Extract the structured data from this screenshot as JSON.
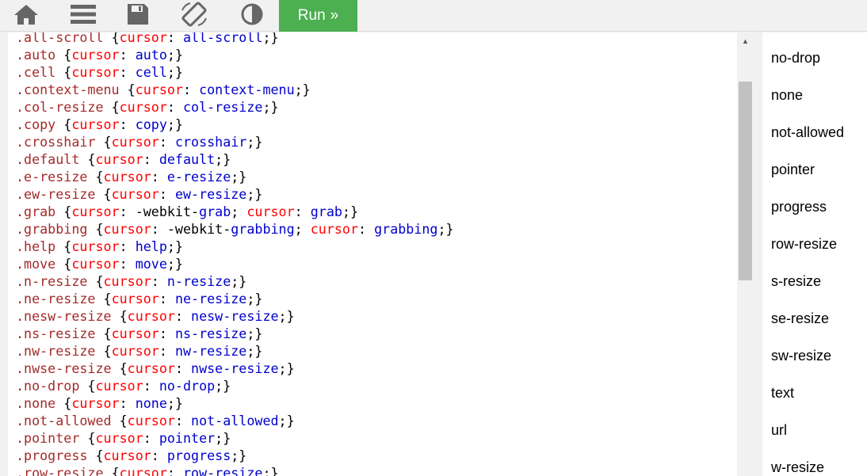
{
  "toolbar": {
    "icons": [
      "home-icon",
      "menu-icon",
      "save-icon",
      "rotate-icon",
      "contrast-icon"
    ],
    "run_label": "Run",
    "run_chevron": "»",
    "run_color": "#4caf50"
  },
  "colors": {
    "selector": "#a52a2a",
    "property": "#ff0000",
    "value": "#0000cd"
  },
  "code_lines": [
    [
      [
        ".all-scroll ",
        "sel"
      ],
      [
        "{",
        "pun"
      ],
      [
        "cursor",
        "prop"
      ],
      [
        ": ",
        "pun"
      ],
      [
        "all-scroll",
        "val"
      ],
      [
        ";}",
        "pun"
      ]
    ],
    [
      [
        ".auto ",
        "sel"
      ],
      [
        "{",
        "pun"
      ],
      [
        "cursor",
        "prop"
      ],
      [
        ": ",
        "pun"
      ],
      [
        "auto",
        "val"
      ],
      [
        ";}",
        "pun"
      ]
    ],
    [
      [
        ".cell ",
        "sel"
      ],
      [
        "{",
        "pun"
      ],
      [
        "cursor",
        "prop"
      ],
      [
        ": ",
        "pun"
      ],
      [
        "cell",
        "val"
      ],
      [
        ";}",
        "pun"
      ]
    ],
    [
      [
        ".context-menu ",
        "sel"
      ],
      [
        "{",
        "pun"
      ],
      [
        "cursor",
        "prop"
      ],
      [
        ": ",
        "pun"
      ],
      [
        "context-menu",
        "val"
      ],
      [
        ";}",
        "pun"
      ]
    ],
    [
      [
        ".col-resize ",
        "sel"
      ],
      [
        "{",
        "pun"
      ],
      [
        "cursor",
        "prop"
      ],
      [
        ": ",
        "pun"
      ],
      [
        "col-resize",
        "val"
      ],
      [
        ";}",
        "pun"
      ]
    ],
    [
      [
        ".copy ",
        "sel"
      ],
      [
        "{",
        "pun"
      ],
      [
        "cursor",
        "prop"
      ],
      [
        ": ",
        "pun"
      ],
      [
        "copy",
        "val"
      ],
      [
        ";}",
        "pun"
      ]
    ],
    [
      [
        ".crosshair ",
        "sel"
      ],
      [
        "{",
        "pun"
      ],
      [
        "cursor",
        "prop"
      ],
      [
        ": ",
        "pun"
      ],
      [
        "crosshair",
        "val"
      ],
      [
        ";}",
        "pun"
      ]
    ],
    [
      [
        ".default ",
        "sel"
      ],
      [
        "{",
        "pun"
      ],
      [
        "cursor",
        "prop"
      ],
      [
        ": ",
        "pun"
      ],
      [
        "default",
        "val"
      ],
      [
        ";}",
        "pun"
      ]
    ],
    [
      [
        ".e-resize ",
        "sel"
      ],
      [
        "{",
        "pun"
      ],
      [
        "cursor",
        "prop"
      ],
      [
        ": ",
        "pun"
      ],
      [
        "e-resize",
        "val"
      ],
      [
        ";}",
        "pun"
      ]
    ],
    [
      [
        ".ew-resize ",
        "sel"
      ],
      [
        "{",
        "pun"
      ],
      [
        "cursor",
        "prop"
      ],
      [
        ": ",
        "pun"
      ],
      [
        "ew-resize",
        "val"
      ],
      [
        ";}",
        "pun"
      ]
    ],
    [
      [
        ".grab ",
        "sel"
      ],
      [
        "{",
        "pun"
      ],
      [
        "cursor",
        "prop"
      ],
      [
        ": -webkit-",
        "pun"
      ],
      [
        "grab",
        "val"
      ],
      [
        "; ",
        "pun"
      ],
      [
        "cursor",
        "prop"
      ],
      [
        ": ",
        "pun"
      ],
      [
        "grab",
        "val"
      ],
      [
        ";}",
        "pun"
      ]
    ],
    [
      [
        ".grabbing ",
        "sel"
      ],
      [
        "{",
        "pun"
      ],
      [
        "cursor",
        "prop"
      ],
      [
        ": -webkit-",
        "pun"
      ],
      [
        "grabbing",
        "val"
      ],
      [
        "; ",
        "pun"
      ],
      [
        "cursor",
        "prop"
      ],
      [
        ": ",
        "pun"
      ],
      [
        "grabbing",
        "val"
      ],
      [
        ";}",
        "pun"
      ]
    ],
    [
      [
        ".help ",
        "sel"
      ],
      [
        "{",
        "pun"
      ],
      [
        "cursor",
        "prop"
      ],
      [
        ": ",
        "pun"
      ],
      [
        "help",
        "val"
      ],
      [
        ";}",
        "pun"
      ]
    ],
    [
      [
        ".move ",
        "sel"
      ],
      [
        "{",
        "pun"
      ],
      [
        "cursor",
        "prop"
      ],
      [
        ": ",
        "pun"
      ],
      [
        "move",
        "val"
      ],
      [
        ";}",
        "pun"
      ]
    ],
    [
      [
        ".n-resize ",
        "sel"
      ],
      [
        "{",
        "pun"
      ],
      [
        "cursor",
        "prop"
      ],
      [
        ": ",
        "pun"
      ],
      [
        "n-resize",
        "val"
      ],
      [
        ";}",
        "pun"
      ]
    ],
    [
      [
        ".ne-resize ",
        "sel"
      ],
      [
        "{",
        "pun"
      ],
      [
        "cursor",
        "prop"
      ],
      [
        ": ",
        "pun"
      ],
      [
        "ne-resize",
        "val"
      ],
      [
        ";}",
        "pun"
      ]
    ],
    [
      [
        ".nesw-resize ",
        "sel"
      ],
      [
        "{",
        "pun"
      ],
      [
        "cursor",
        "prop"
      ],
      [
        ": ",
        "pun"
      ],
      [
        "nesw-resize",
        "val"
      ],
      [
        ";}",
        "pun"
      ]
    ],
    [
      [
        ".ns-resize ",
        "sel"
      ],
      [
        "{",
        "pun"
      ],
      [
        "cursor",
        "prop"
      ],
      [
        ": ",
        "pun"
      ],
      [
        "ns-resize",
        "val"
      ],
      [
        ";}",
        "pun"
      ]
    ],
    [
      [
        ".nw-resize ",
        "sel"
      ],
      [
        "{",
        "pun"
      ],
      [
        "cursor",
        "prop"
      ],
      [
        ": ",
        "pun"
      ],
      [
        "nw-resize",
        "val"
      ],
      [
        ";}",
        "pun"
      ]
    ],
    [
      [
        ".nwse-resize ",
        "sel"
      ],
      [
        "{",
        "pun"
      ],
      [
        "cursor",
        "prop"
      ],
      [
        ": ",
        "pun"
      ],
      [
        "nwse-resize",
        "val"
      ],
      [
        ";}",
        "pun"
      ]
    ],
    [
      [
        ".no-drop ",
        "sel"
      ],
      [
        "{",
        "pun"
      ],
      [
        "cursor",
        "prop"
      ],
      [
        ": ",
        "pun"
      ],
      [
        "no-drop",
        "val"
      ],
      [
        ";}",
        "pun"
      ]
    ],
    [
      [
        ".none ",
        "sel"
      ],
      [
        "{",
        "pun"
      ],
      [
        "cursor",
        "prop"
      ],
      [
        ": ",
        "pun"
      ],
      [
        "none",
        "val"
      ],
      [
        ";}",
        "pun"
      ]
    ],
    [
      [
        ".not-allowed ",
        "sel"
      ],
      [
        "{",
        "pun"
      ],
      [
        "cursor",
        "prop"
      ],
      [
        ": ",
        "pun"
      ],
      [
        "not-allowed",
        "val"
      ],
      [
        ";}",
        "pun"
      ]
    ],
    [
      [
        ".pointer ",
        "sel"
      ],
      [
        "{",
        "pun"
      ],
      [
        "cursor",
        "prop"
      ],
      [
        ": ",
        "pun"
      ],
      [
        "pointer",
        "val"
      ],
      [
        ";}",
        "pun"
      ]
    ],
    [
      [
        ".progress ",
        "sel"
      ],
      [
        "{",
        "pun"
      ],
      [
        "cursor",
        "prop"
      ],
      [
        ": ",
        "pun"
      ],
      [
        "progress",
        "val"
      ],
      [
        ";}",
        "pun"
      ]
    ],
    [
      [
        ".row-resize ",
        "sel"
      ],
      [
        "{",
        "pun"
      ],
      [
        "cursor",
        "prop"
      ],
      [
        ": ",
        "pun"
      ],
      [
        "row-resize",
        "val"
      ],
      [
        ";}",
        "pun"
      ]
    ]
  ],
  "result_items": [
    "no-drop",
    "none",
    "not-allowed",
    "pointer",
    "progress",
    "row-resize",
    "s-resize",
    "se-resize",
    "sw-resize",
    "text",
    "url",
    "w-resize"
  ],
  "scrollbar": {
    "up_arrow": "▲",
    "position_fraction": 0.18
  }
}
